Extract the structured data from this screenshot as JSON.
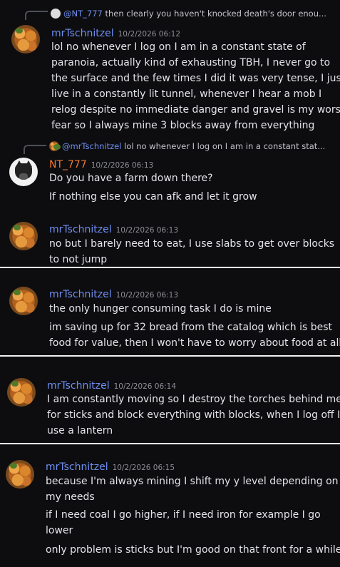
{
  "messages": [
    {
      "reply": {
        "author": "@NT_777",
        "text": "then clearly you haven't knocked death's door enou..."
      },
      "author": "mrTschnitzel",
      "timestamp": "10/2/2026 06:12",
      "lines": [
        "lol no whenever I log on I am in a constant state of",
        "paranoia, actually kind of exhausting TBH, I never go to",
        "the surface and the few times I did it was very tense, I just",
        "live in a constantly lit tunnel, whenever I hear a mob I",
        "relog despite no immediate danger and gravel is my worst",
        "fear so I always mine 3 blocks away from everything"
      ]
    },
    {
      "reply": {
        "author": "@mrTschnitzel",
        "text": "lol no whenever I log on I am in a constant stat..."
      },
      "author": "NT_777",
      "timestamp": "10/2/2026 06:13",
      "lines": [
        "Do you have a farm down there?",
        "If nothing else you can afk and let it grow"
      ]
    },
    {
      "author": "mrTschnitzel",
      "timestamp": "10/2/2026 06:13",
      "lines": [
        "no but I barely need to eat, I use slabs to get over blocks",
        "to not jump"
      ]
    },
    {
      "author": "mrTschnitzel",
      "timestamp": "10/2/2026 06:13",
      "lines": [
        "the only hunger consuming task I do is mine",
        "im saving up for 32 bread from the catalog which is best",
        "food for value, then I won't have to worry about food at all"
      ]
    },
    {
      "author": "mrTschnitzel",
      "timestamp": "10/2/2026 06:14",
      "lines": [
        "I am constantly moving so I destroy the torches behind me",
        "for sticks and block everything with blocks, when I log off I",
        "use a lantern"
      ]
    },
    {
      "author": "mrTschnitzel",
      "timestamp": "10/2/2026 06:15",
      "lines": [
        "because I'm always mining I shift my y level depending on",
        "my needs",
        "if I need coal I go higher, if I need iron for example I go",
        "lower",
        "only problem is sticks but I'm good on that front for a while"
      ]
    }
  ],
  "colors": {
    "username": "#6f8ff0",
    "username_alt": "#f27a2e",
    "background": "#0d0d10"
  }
}
